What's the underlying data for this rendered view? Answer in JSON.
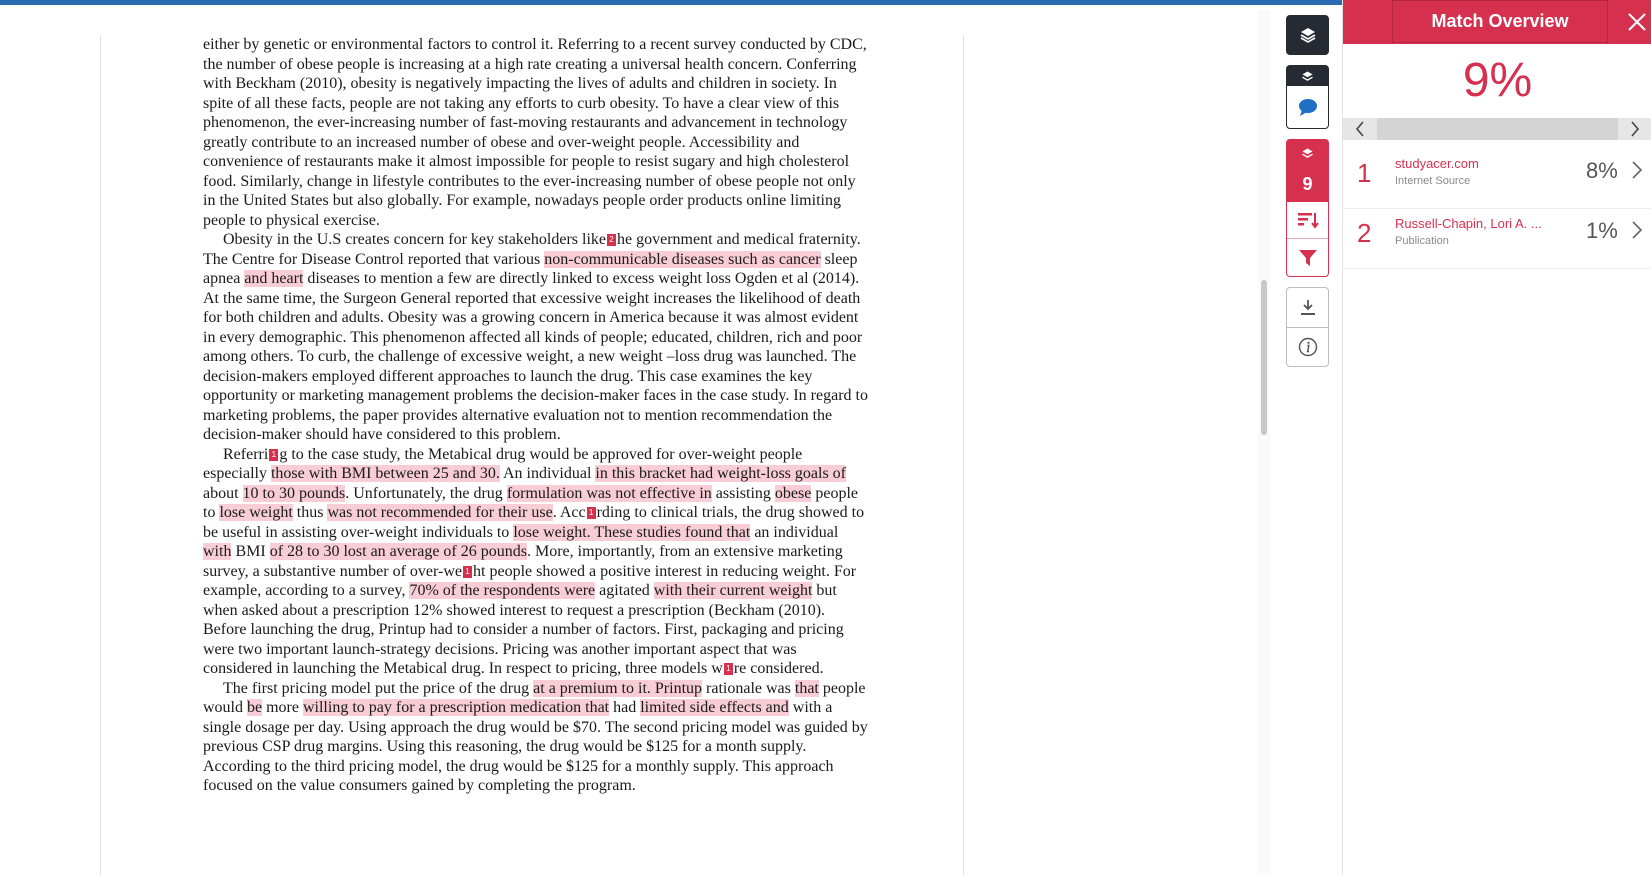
{
  "document": {
    "paragraphs": [
      [
        {
          "t": "either by genetic or environmental factors to control it. Referring to a recent survey conducted by CDC, the number of obese people is increasing at a high rate creating a universal health concern. Conferring with Beckham (2010), obesity is negatively impacting the lives of adults and children in society. In spite of all these facts, people are not taking any efforts to curb obesity. To have a clear view of this phenomenon, the ever-increasing number of fast-moving restaurants and advancement in technology greatly contribute to an increased number of obese and over-weight people. Accessibility and convenience of restaurants make it almost impossible for people to resist sugary and high cholesterol food. Similarly, change in lifestyle contributes to the ever-increasing number of obese people not only in the United States but also globally. For example, nowadays people order products online limiting people to physical exercise."
        }
      ],
      [
        {
          "t": "     Obesity in the U.S creates concern for key stakeholders like"
        },
        {
          "m": "2"
        },
        {
          "t": "he government and medical fraternity. The Centre for Disease Control reported that various "
        },
        {
          "h": "non-communicable diseases such as cancer"
        },
        {
          "t": " sleep apnea "
        },
        {
          "h": "and heart"
        },
        {
          "t": " diseases to mention a few are directly linked to excess weight loss Ogden et al (2014). At the same time, the Surgeon General reported that excessive weight increases the likelihood of death for both children and adults. Obesity was a growing concern in America because it was almost evident in every demographic. This phenomenon affected all kinds of people; educated, children, rich and poor among others. To curb, the challenge of excessive weight, a new weight –loss drug was launched. The decision-makers employed different approaches to launch the drug. This case examines the key opportunity or marketing management problems the decision-maker faces in the case study. In regard to marketing problems, the paper provides alternative evaluation not to mention recommendation the decision-maker should have considered to this problem."
        }
      ],
      [
        {
          "t": "     Referri"
        },
        {
          "m": "1"
        },
        {
          "t": "g to the case study, the Metabical drug would be approved for over-weight people especially "
        },
        {
          "h": "those with BMI between 25 and 30."
        },
        {
          "t": "  An individual "
        },
        {
          "h": "in this bracket had weight-loss goals of"
        },
        {
          "t": " about "
        },
        {
          "h": "10 to 30 pounds"
        },
        {
          "t": ". Unfortunately, the drug "
        },
        {
          "h": "formulation was not effective in"
        },
        {
          "t": " assisting "
        },
        {
          "h": "obese"
        },
        {
          "t": " people to "
        },
        {
          "h": "lose weight"
        },
        {
          "t": " thus "
        },
        {
          "h": "was not recommended for their use"
        },
        {
          "t": ". Acc"
        },
        {
          "m": "1"
        },
        {
          "t": "rding to clinical trials, the drug showed to be useful in assisting over-weight individuals to "
        },
        {
          "h": "lose weight. These studies found that"
        },
        {
          "t": " an individual "
        },
        {
          "h": "with"
        },
        {
          "t": " BMI "
        },
        {
          "h": "of 28 to 30 lost an average of 26 pounds"
        },
        {
          "t": ". More, importantly, from an extensive marketing survey, a substantive number of over-we"
        },
        {
          "m": "1"
        },
        {
          "t": "ht people showed a positive interest in reducing weight. For example, according to a survey, "
        },
        {
          "h": "70% of the respondents were"
        },
        {
          "t": " agitated "
        },
        {
          "h": "with their current weight"
        },
        {
          "t": " but when asked about a prescription 12% showed interest to request a prescription (Beckham (2010). Before launching the drug, Printup had to consider a number of factors. First, packaging and pricing were two important launch-strategy decisions. Pricing was another important aspect that was considered in launching the Metabical drug. In respect to pricing, three models w"
        },
        {
          "m": "1"
        },
        {
          "t": "re considered."
        }
      ],
      [
        {
          "t": "     The first pricing model put the price of the drug "
        },
        {
          "h": "at a premium to it. Printup"
        },
        {
          "t": " rationale was "
        },
        {
          "h": "that"
        },
        {
          "t": " people would "
        },
        {
          "h": "be"
        },
        {
          "t": " more "
        },
        {
          "h": "willing to pay for a prescription medication that"
        },
        {
          "t": " had "
        },
        {
          "h": "limited side effects and"
        },
        {
          "t": " with a single dosage per day. Using approach the drug would be $70. The second pricing model was guided by previous CSP drug margins. Using this reasoning, the drug would be $125 for a month supply. According to the third pricing model, the drug would be $125 for a monthly supply. This approach focused on the value consumers gained by completing the program."
        }
      ]
    ]
  },
  "toolbar": {
    "match_count": "9",
    "icons": [
      "layers-icon",
      "comment-icon",
      "sort-icon",
      "filter-icon",
      "download-icon",
      "info-icon"
    ]
  },
  "panel": {
    "title": "Match Overview",
    "overall_percent": "9%",
    "sources": [
      {
        "number": "1",
        "name": "studyacer.com",
        "type": "Internet Source",
        "percent": "8%"
      },
      {
        "number": "2",
        "name": "Russell-Chapin, Lori A. ...",
        "type": "Publication",
        "percent": "1%"
      }
    ]
  },
  "colors": {
    "accent": "#d6304f",
    "highlight": "#f8cdd5",
    "topbar": "#2b6cb0",
    "dark": "#262a33"
  }
}
